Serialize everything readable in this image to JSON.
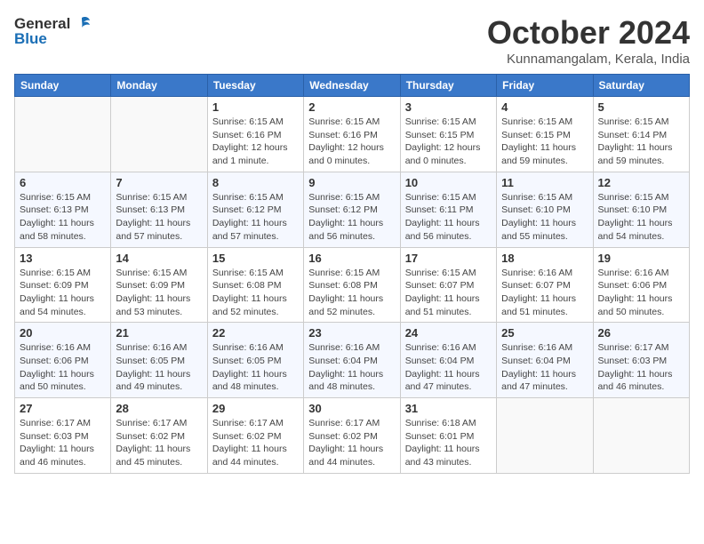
{
  "logo": {
    "general": "General",
    "blue": "Blue"
  },
  "title": "October 2024",
  "location": "Kunnamangalam, Kerala, India",
  "days_header": [
    "Sunday",
    "Monday",
    "Tuesday",
    "Wednesday",
    "Thursday",
    "Friday",
    "Saturday"
  ],
  "weeks": [
    [
      {
        "day": "",
        "info": ""
      },
      {
        "day": "",
        "info": ""
      },
      {
        "day": "1",
        "info": "Sunrise: 6:15 AM\nSunset: 6:16 PM\nDaylight: 12 hours and 1 minute."
      },
      {
        "day": "2",
        "info": "Sunrise: 6:15 AM\nSunset: 6:16 PM\nDaylight: 12 hours and 0 minutes."
      },
      {
        "day": "3",
        "info": "Sunrise: 6:15 AM\nSunset: 6:15 PM\nDaylight: 12 hours and 0 minutes."
      },
      {
        "day": "4",
        "info": "Sunrise: 6:15 AM\nSunset: 6:15 PM\nDaylight: 11 hours and 59 minutes."
      },
      {
        "day": "5",
        "info": "Sunrise: 6:15 AM\nSunset: 6:14 PM\nDaylight: 11 hours and 59 minutes."
      }
    ],
    [
      {
        "day": "6",
        "info": "Sunrise: 6:15 AM\nSunset: 6:13 PM\nDaylight: 11 hours and 58 minutes."
      },
      {
        "day": "7",
        "info": "Sunrise: 6:15 AM\nSunset: 6:13 PM\nDaylight: 11 hours and 57 minutes."
      },
      {
        "day": "8",
        "info": "Sunrise: 6:15 AM\nSunset: 6:12 PM\nDaylight: 11 hours and 57 minutes."
      },
      {
        "day": "9",
        "info": "Sunrise: 6:15 AM\nSunset: 6:12 PM\nDaylight: 11 hours and 56 minutes."
      },
      {
        "day": "10",
        "info": "Sunrise: 6:15 AM\nSunset: 6:11 PM\nDaylight: 11 hours and 56 minutes."
      },
      {
        "day": "11",
        "info": "Sunrise: 6:15 AM\nSunset: 6:10 PM\nDaylight: 11 hours and 55 minutes."
      },
      {
        "day": "12",
        "info": "Sunrise: 6:15 AM\nSunset: 6:10 PM\nDaylight: 11 hours and 54 minutes."
      }
    ],
    [
      {
        "day": "13",
        "info": "Sunrise: 6:15 AM\nSunset: 6:09 PM\nDaylight: 11 hours and 54 minutes."
      },
      {
        "day": "14",
        "info": "Sunrise: 6:15 AM\nSunset: 6:09 PM\nDaylight: 11 hours and 53 minutes."
      },
      {
        "day": "15",
        "info": "Sunrise: 6:15 AM\nSunset: 6:08 PM\nDaylight: 11 hours and 52 minutes."
      },
      {
        "day": "16",
        "info": "Sunrise: 6:15 AM\nSunset: 6:08 PM\nDaylight: 11 hours and 52 minutes."
      },
      {
        "day": "17",
        "info": "Sunrise: 6:15 AM\nSunset: 6:07 PM\nDaylight: 11 hours and 51 minutes."
      },
      {
        "day": "18",
        "info": "Sunrise: 6:16 AM\nSunset: 6:07 PM\nDaylight: 11 hours and 51 minutes."
      },
      {
        "day": "19",
        "info": "Sunrise: 6:16 AM\nSunset: 6:06 PM\nDaylight: 11 hours and 50 minutes."
      }
    ],
    [
      {
        "day": "20",
        "info": "Sunrise: 6:16 AM\nSunset: 6:06 PM\nDaylight: 11 hours and 50 minutes."
      },
      {
        "day": "21",
        "info": "Sunrise: 6:16 AM\nSunset: 6:05 PM\nDaylight: 11 hours and 49 minutes."
      },
      {
        "day": "22",
        "info": "Sunrise: 6:16 AM\nSunset: 6:05 PM\nDaylight: 11 hours and 48 minutes."
      },
      {
        "day": "23",
        "info": "Sunrise: 6:16 AM\nSunset: 6:04 PM\nDaylight: 11 hours and 48 minutes."
      },
      {
        "day": "24",
        "info": "Sunrise: 6:16 AM\nSunset: 6:04 PM\nDaylight: 11 hours and 47 minutes."
      },
      {
        "day": "25",
        "info": "Sunrise: 6:16 AM\nSunset: 6:04 PM\nDaylight: 11 hours and 47 minutes."
      },
      {
        "day": "26",
        "info": "Sunrise: 6:17 AM\nSunset: 6:03 PM\nDaylight: 11 hours and 46 minutes."
      }
    ],
    [
      {
        "day": "27",
        "info": "Sunrise: 6:17 AM\nSunset: 6:03 PM\nDaylight: 11 hours and 46 minutes."
      },
      {
        "day": "28",
        "info": "Sunrise: 6:17 AM\nSunset: 6:02 PM\nDaylight: 11 hours and 45 minutes."
      },
      {
        "day": "29",
        "info": "Sunrise: 6:17 AM\nSunset: 6:02 PM\nDaylight: 11 hours and 44 minutes."
      },
      {
        "day": "30",
        "info": "Sunrise: 6:17 AM\nSunset: 6:02 PM\nDaylight: 11 hours and 44 minutes."
      },
      {
        "day": "31",
        "info": "Sunrise: 6:18 AM\nSunset: 6:01 PM\nDaylight: 11 hours and 43 minutes."
      },
      {
        "day": "",
        "info": ""
      },
      {
        "day": "",
        "info": ""
      }
    ]
  ]
}
